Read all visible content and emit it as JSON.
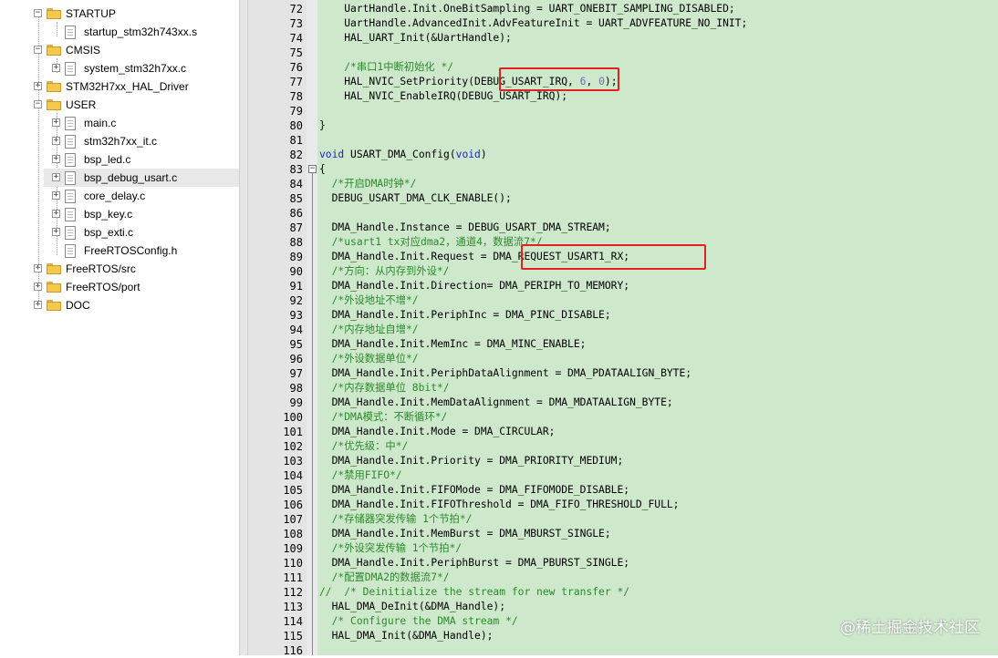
{
  "tree": {
    "items": [
      {
        "label": "STARTUP",
        "type": "folder",
        "expanded": true,
        "selected": false
      },
      {
        "label": "startup_stm32h743xx.s",
        "type": "file",
        "expandable": false,
        "selected": false
      },
      {
        "label": "CMSIS",
        "type": "folder",
        "expanded": true,
        "selected": false
      },
      {
        "label": "system_stm32h7xx.c",
        "type": "file",
        "expandable": true,
        "selected": false
      },
      {
        "label": "STM32H7xx_HAL_Driver",
        "type": "folder",
        "expanded": false,
        "selected": false
      },
      {
        "label": "USER",
        "type": "folder",
        "expanded": true,
        "selected": false
      },
      {
        "label": "main.c",
        "type": "file",
        "expandable": true,
        "selected": false
      },
      {
        "label": "stm32h7xx_it.c",
        "type": "file",
        "expandable": true,
        "selected": false
      },
      {
        "label": "bsp_led.c",
        "type": "file",
        "expandable": true,
        "selected": false
      },
      {
        "label": "bsp_debug_usart.c",
        "type": "file",
        "expandable": true,
        "selected": true
      },
      {
        "label": "core_delay.c",
        "type": "file",
        "expandable": true,
        "selected": false
      },
      {
        "label": "bsp_key.c",
        "type": "file",
        "expandable": true,
        "selected": false
      },
      {
        "label": "bsp_exti.c",
        "type": "file",
        "expandable": true,
        "selected": false
      },
      {
        "label": "FreeRTOSConfig.h",
        "type": "file",
        "expandable": false,
        "selected": false
      },
      {
        "label": "FreeRTOS/src",
        "type": "folder",
        "expanded": false,
        "selected": false
      },
      {
        "label": "FreeRTOS/port",
        "type": "folder",
        "expanded": false,
        "selected": false
      },
      {
        "label": "DOC",
        "type": "folder",
        "expanded": false,
        "selected": false
      }
    ]
  },
  "editor": {
    "lines": [
      {
        "n": "72",
        "text": "    UartHandle.Init.OneBitSampling = UART_ONEBIT_SAMPLING_DISABLED;"
      },
      {
        "n": "73",
        "text": "    UartHandle.AdvancedInit.AdvFeatureInit = UART_ADVFEATURE_NO_INIT;"
      },
      {
        "n": "74",
        "text": "    HAL_UART_Init(&UartHandle);"
      },
      {
        "n": "75",
        "text": ""
      },
      {
        "n": "76",
        "text": "    /*串口1中断初始化 */"
      },
      {
        "n": "77",
        "text": "    HAL_NVIC_SetPriority(DEBUG_USART_IRQ, 6, 0);"
      },
      {
        "n": "78",
        "text": "    HAL_NVIC_EnableIRQ(DEBUG_USART_IRQ);"
      },
      {
        "n": "79",
        "text": ""
      },
      {
        "n": "80",
        "text": "}"
      },
      {
        "n": "81",
        "text": ""
      },
      {
        "n": "82",
        "text": "void USART_DMA_Config(void)"
      },
      {
        "n": "83",
        "text": "{"
      },
      {
        "n": "84",
        "text": "  /*开启DMA时钟*/"
      },
      {
        "n": "85",
        "text": "  DEBUG_USART_DMA_CLK_ENABLE();"
      },
      {
        "n": "86",
        "text": ""
      },
      {
        "n": "87",
        "text": "  DMA_Handle.Instance = DEBUG_USART_DMA_STREAM;"
      },
      {
        "n": "88",
        "text": "  /*usart1 tx对应dma2，通道4，数据流7*/"
      },
      {
        "n": "89",
        "text": "  DMA_Handle.Init.Request = DMA_REQUEST_USART1_RX;"
      },
      {
        "n": "90",
        "text": "  /*方向：从内存到外设*/"
      },
      {
        "n": "91",
        "text": "  DMA_Handle.Init.Direction= DMA_PERIPH_TO_MEMORY;"
      },
      {
        "n": "92",
        "text": "  /*外设地址不增*/"
      },
      {
        "n": "93",
        "text": "  DMA_Handle.Init.PeriphInc = DMA_PINC_DISABLE;"
      },
      {
        "n": "94",
        "text": "  /*内存地址自增*/"
      },
      {
        "n": "95",
        "text": "  DMA_Handle.Init.MemInc = DMA_MINC_ENABLE;"
      },
      {
        "n": "96",
        "text": "  /*外设数据单位*/"
      },
      {
        "n": "97",
        "text": "  DMA_Handle.Init.PeriphDataAlignment = DMA_PDATAALIGN_BYTE;"
      },
      {
        "n": "98",
        "text": "  /*内存数据单位 8bit*/"
      },
      {
        "n": "99",
        "text": "  DMA_Handle.Init.MemDataAlignment = DMA_MDATAALIGN_BYTE;"
      },
      {
        "n": "100",
        "text": "  /*DMA模式：不断循环*/"
      },
      {
        "n": "101",
        "text": "  DMA_Handle.Init.Mode = DMA_CIRCULAR;"
      },
      {
        "n": "102",
        "text": "  /*优先级：中*/"
      },
      {
        "n": "103",
        "text": "  DMA_Handle.Init.Priority = DMA_PRIORITY_MEDIUM;"
      },
      {
        "n": "104",
        "text": "  /*禁用FIFO*/"
      },
      {
        "n": "105",
        "text": "  DMA_Handle.Init.FIFOMode = DMA_FIFOMODE_DISABLE;"
      },
      {
        "n": "106",
        "text": "  DMA_Handle.Init.FIFOThreshold = DMA_FIFO_THRESHOLD_FULL;"
      },
      {
        "n": "107",
        "text": "  /*存储器突发传输 1个节拍*/"
      },
      {
        "n": "108",
        "text": "  DMA_Handle.Init.MemBurst = DMA_MBURST_SINGLE;"
      },
      {
        "n": "109",
        "text": "  /*外设突发传输 1个节拍*/"
      },
      {
        "n": "110",
        "text": "  DMA_Handle.Init.PeriphBurst = DMA_PBURST_SINGLE;"
      },
      {
        "n": "111",
        "text": "  /*配置DMA2的数据流7*/"
      },
      {
        "n": "112",
        "text": "//  /* Deinitialize the stream for new transfer */"
      },
      {
        "n": "113",
        "text": "  HAL_DMA_DeInit(&DMA_Handle);"
      },
      {
        "n": "114",
        "text": "  /* Configure the DMA stream */"
      },
      {
        "n": "115",
        "text": "  HAL_DMA_Init(&DMA_Handle);"
      },
      {
        "n": "116",
        "text": ""
      }
    ],
    "highlights": [
      "DEBUG_USART_IRQ,",
      "DMA_REQUEST_USART1_RX;"
    ]
  },
  "watermark": "@稀土掘金技术社区",
  "colors": {
    "editor_bg": "#cde8cb",
    "keyword": "#1f1fd6",
    "comment": "#2a8a2a",
    "highlight_box": "#e0231e"
  }
}
